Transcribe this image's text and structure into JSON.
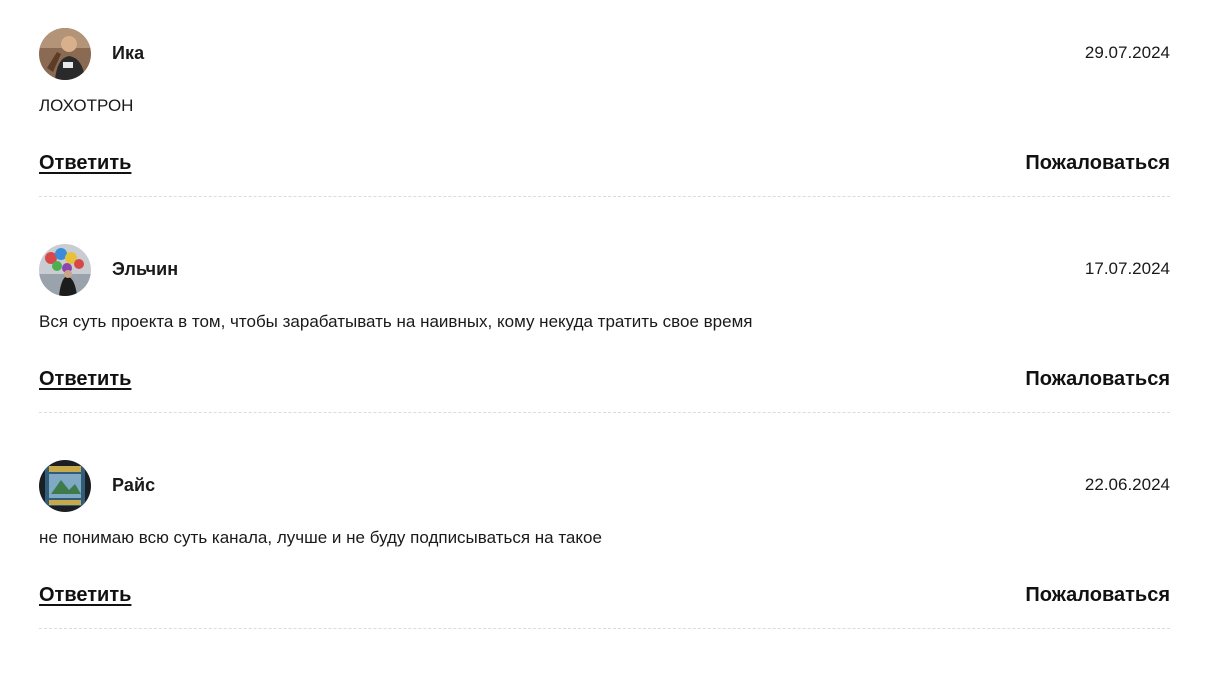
{
  "comments": [
    {
      "author": "Ика",
      "date": "29.07.2024",
      "text": "ЛОХОТРОН",
      "reply_label": "Ответить",
      "report_label": "Пожаловаться"
    },
    {
      "author": "Эльчин",
      "date": "17.07.2024",
      "text": "Вся суть проекта в том, чтобы зарабатывать на наивных, кому некуда тратить свое время",
      "reply_label": "Ответить",
      "report_label": "Пожаловаться"
    },
    {
      "author": "Райс",
      "date": "22.06.2024",
      "text": "не понимаю всю суть канала, лучше и не буду подписываться на такое",
      "reply_label": "Ответить",
      "report_label": "Пожаловаться"
    }
  ]
}
